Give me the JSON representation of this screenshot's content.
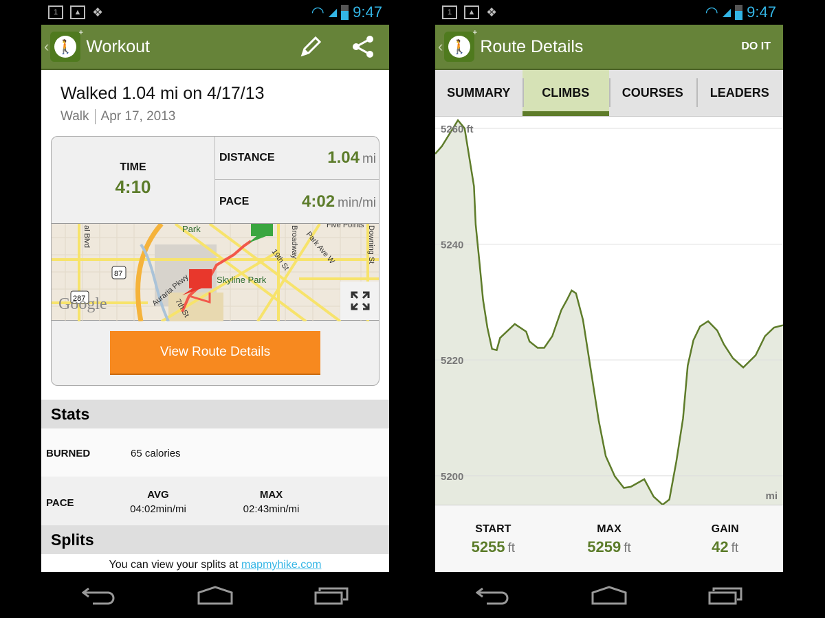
{
  "status_bar": {
    "time": "9:47",
    "notification_icons": [
      "calendar-icon",
      "gallery-icon",
      "dropbox-icon"
    ],
    "system_icons": [
      "wifi-icon",
      "signal-icon",
      "battery-icon"
    ],
    "calendar_day": "1",
    "time_color": "#33b5e5"
  },
  "colors": {
    "action_bar": "#668339",
    "accent_green": "#5c7c2a",
    "button_orange": "#f7891f",
    "link": "#33b5e5"
  },
  "left_screen": {
    "action_bar": {
      "title": "Workout",
      "actions": [
        "pencil-icon",
        "share-icon"
      ]
    },
    "title": "Walked 1.04 mi on 4/17/13",
    "activity": "Walk",
    "date": "Apr 17, 2013",
    "summary": {
      "time": {
        "label": "TIME",
        "value": "4:10"
      },
      "distance": {
        "label": "DISTANCE",
        "value": "1.04",
        "unit": "mi"
      },
      "pace": {
        "label": "PACE",
        "value": "4:02",
        "unit": "min/mi"
      }
    },
    "map": {
      "labels": [
        "Park",
        "Skyline Park",
        "Auraria Pkwy",
        "7th St",
        "19th St",
        "Park Ave W",
        "Broadway",
        "Downing St",
        "Five Points",
        "al Blvd"
      ],
      "shields": [
        "87",
        "287"
      ],
      "logo": "Google"
    },
    "view_route_button": "View Route Details",
    "stats": {
      "heading": "Stats",
      "burned": {
        "label": "BURNED",
        "value": "65 calories"
      },
      "pace": {
        "label": "PACE",
        "avg_label": "AVG",
        "avg_value": "04:02min/mi",
        "max_label": "MAX",
        "max_value": "02:43min/mi"
      }
    },
    "splits": {
      "heading": "Splits",
      "text": "You can view your splits at ",
      "link": "mapmyhike.com"
    }
  },
  "right_screen": {
    "action_bar": {
      "title": "Route Details",
      "action": "DO IT"
    },
    "tabs": [
      {
        "label": "SUMMARY",
        "active": false
      },
      {
        "label": "CLIMBS",
        "active": true
      },
      {
        "label": "COURSES",
        "active": false
      },
      {
        "label": "LEADERS",
        "active": false
      }
    ],
    "footer": {
      "start": {
        "label": "START",
        "value": "5255",
        "unit": "ft"
      },
      "max": {
        "label": "MAX",
        "value": "5259",
        "unit": "ft"
      },
      "gain": {
        "label": "GAIN",
        "value": "42",
        "unit": "ft"
      }
    }
  },
  "chart_data": {
    "type": "area",
    "xlabel": "mi",
    "ylabel": "ft",
    "y_ticks": [
      "5260 ft",
      "5240",
      "5220",
      "5200"
    ],
    "y_tick_values": [
      5260,
      5240,
      5220,
      5200
    ],
    "ylim": [
      5195,
      5262
    ],
    "xlim": [
      0,
      1.04
    ],
    "grid": true,
    "line_color": "#5e7c2a",
    "fill_color": "#e6eadf",
    "x": [
      0,
      0.02,
      0.068,
      0.088,
      0.105,
      0.116,
      0.121,
      0.133,
      0.143,
      0.156,
      0.17,
      0.184,
      0.194,
      0.238,
      0.272,
      0.282,
      0.306,
      0.326,
      0.35,
      0.377,
      0.394,
      0.408,
      0.421,
      0.442,
      0.469,
      0.489,
      0.51,
      0.537,
      0.564,
      0.585,
      0.625,
      0.653,
      0.68,
      0.7,
      0.721,
      0.741,
      0.755,
      0.772,
      0.792,
      0.816,
      0.843,
      0.863,
      0.89,
      0.921,
      0.958,
      0.986,
      1.013,
      1.04
    ],
    "y": [
      5255.6,
      5256.9,
      5261.4,
      5260,
      5253.9,
      5250,
      5243.4,
      5236.5,
      5230.4,
      5225.6,
      5221.9,
      5221.7,
      5223.8,
      5226.2,
      5224.9,
      5223.2,
      5222.1,
      5222.1,
      5224.1,
      5228.6,
      5230.4,
      5232,
      5231.5,
      5226.9,
      5216.9,
      5209.5,
      5203.4,
      5199.9,
      5197.9,
      5198.1,
      5199.4,
      5196.4,
      5195,
      5195.9,
      5202.5,
      5209.9,
      5219,
      5223.4,
      5225.8,
      5226.7,
      5225.1,
      5222.7,
      5220.3,
      5218.7,
      5220.8,
      5224.1,
      5225.6,
      5226
    ]
  }
}
